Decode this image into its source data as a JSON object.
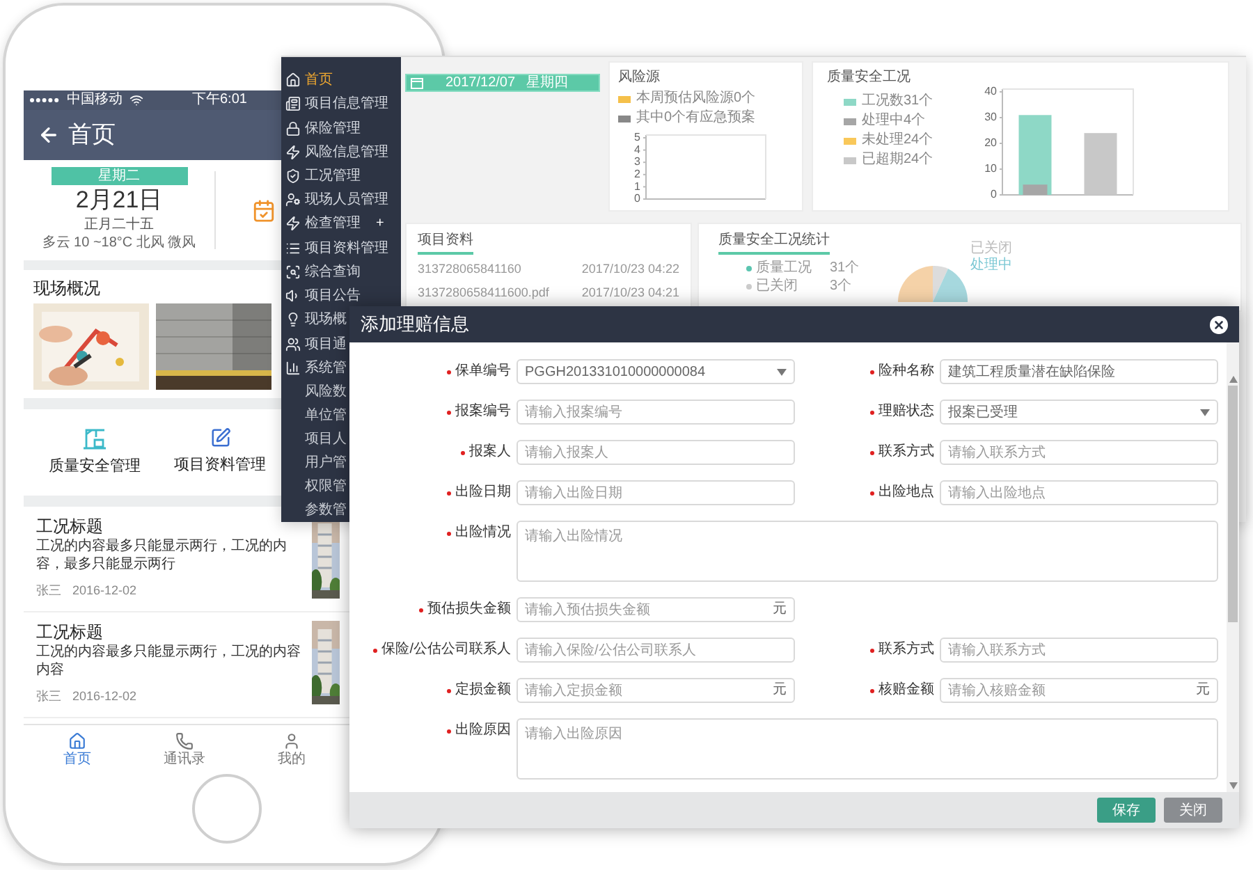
{
  "phone": {
    "status_bar": {
      "carrier": "中国移动",
      "time": "下午6:01"
    },
    "header": {
      "title": "首页"
    },
    "date_card": {
      "weekday": "星期二",
      "date": "2月21日",
      "lunar": "正月二十五",
      "weather": "多云 10 ~18°C 北风 微风"
    },
    "site_overview": {
      "title": "现场概况"
    },
    "shortcuts": [
      {
        "label": "质量安全管理",
        "kind": "crane"
      },
      {
        "label": "项目资料管理",
        "kind": "edit"
      }
    ],
    "news": [
      {
        "title": "工况标题",
        "content": "工况的内容最多只能显示两行，工况的内容，最多只能显示两行",
        "author": "张三",
        "date": "2016-12-02"
      },
      {
        "title": "工况标题",
        "content": "工况的内容最多只能显示两行，工况的内容内容",
        "author": "张三",
        "date": "2016-12-02"
      }
    ],
    "tab_bar": [
      {
        "label": "首页",
        "kind": "home",
        "selected": true
      },
      {
        "label": "通讯录",
        "kind": "phone",
        "selected": false
      },
      {
        "label": "我的",
        "kind": "user",
        "selected": false
      }
    ]
  },
  "dashboard": {
    "sidebar": {
      "items": [
        {
          "label": "首页",
          "kind": "home",
          "selected": true
        },
        {
          "label": "项目信息管理",
          "kind": "news",
          "selected": false
        },
        {
          "label": "保险管理",
          "kind": "lock",
          "selected": false
        },
        {
          "label": "风险信息管理",
          "kind": "bolt",
          "selected": false
        },
        {
          "label": "工况管理",
          "kind": "shield",
          "selected": false
        },
        {
          "label": "现场人员管理",
          "kind": "users",
          "selected": false
        },
        {
          "label": "检查管理",
          "kind": "bolt",
          "selected": false,
          "sign": "+"
        },
        {
          "label": "项目资料管理",
          "kind": "list",
          "selected": false
        },
        {
          "label": "综合查询",
          "kind": "search",
          "selected": false
        },
        {
          "label": "项目公告",
          "kind": "speaker",
          "selected": false
        },
        {
          "label": "现场概",
          "kind": "bulb",
          "selected": false
        },
        {
          "label": "项目通",
          "kind": "group",
          "selected": false
        },
        {
          "label": "系统管",
          "kind": "chart",
          "selected": false,
          "children": [
            {
              "label": "风险数",
              "selected": false
            },
            {
              "label": "单位管",
              "selected": false
            },
            {
              "label": "项目人",
              "selected": false
            },
            {
              "label": "用户管",
              "selected": false
            },
            {
              "label": "权限管",
              "selected": false
            },
            {
              "label": "参数管",
              "selected": false
            }
          ]
        }
      ]
    },
    "date_bar": {
      "date": "2017/12/07",
      "weekday": "星期四"
    },
    "risk_card": {
      "title": "风险源",
      "chart_data": {
        "type": "bar",
        "ylim": [
          0,
          5
        ],
        "yticks": [
          0,
          1,
          2,
          3,
          4,
          5
        ],
        "series": [
          {
            "name": "本周预估风险源0个",
            "color": "#f5c04a",
            "values": [
              0
            ]
          },
          {
            "name": "其中0个有应急预案",
            "color": "#888888",
            "values": [
              0
            ]
          }
        ]
      }
    },
    "quality_card": {
      "title": "质量安全工况",
      "chart_data": {
        "type": "bar",
        "ylim": [
          0,
          40
        ],
        "yticks": [
          0,
          10,
          20,
          30,
          40
        ],
        "series": [
          {
            "name": "工况数31个",
            "color": "#8ed8c6",
            "values": [
              31,
              null
            ]
          },
          {
            "name": "处理中4个",
            "color": "#a6a6a6",
            "values": [
              4,
              null
            ]
          },
          {
            "name": "未处理24个",
            "color": "#f9c85a",
            "values": [
              null,
              null
            ]
          },
          {
            "name": "已超期24个",
            "color": "#c8c8c8",
            "values": [
              null,
              24
            ]
          }
        ]
      }
    },
    "documents": {
      "title": "项目资料",
      "rows": [
        {
          "file": "313728065841160",
          "time": "2017/10/23 04:22"
        },
        {
          "file": "3137280658411600.pdf",
          "time": "2017/10/23 04:21"
        }
      ]
    },
    "stats": {
      "title": "质量安全工况统计",
      "legend": [
        {
          "label": "质量工况",
          "count": "31个",
          "color": "#5bc5b0"
        },
        {
          "label": "已关闭",
          "count": "3个",
          "color": "#cccccc"
        }
      ],
      "pie_labels": [
        {
          "label": "已关闭",
          "color": "#bbbbbb"
        },
        {
          "label": "处理中",
          "color": "#7cc8d4"
        }
      ]
    }
  },
  "dialog": {
    "title": "添加理赔信息",
    "rows": [
      [
        {
          "label": "保单编号",
          "kind": "select",
          "value": "PGGH201331010000000084",
          "required": true
        },
        {
          "label": "险种名称",
          "kind": "text",
          "value": "建筑工程质量潜在缺陷保险",
          "required": true
        }
      ],
      [
        {
          "label": "报案编号",
          "kind": "text",
          "placeholder": "请输入报案编号",
          "required": true
        },
        {
          "label": "理赔状态",
          "kind": "select",
          "value": "报案已受理",
          "required": true
        }
      ],
      [
        {
          "label": "报案人",
          "kind": "text",
          "placeholder": "请输入报案人",
          "required": true
        },
        {
          "label": "联系方式",
          "kind": "text",
          "placeholder": "请输入联系方式",
          "required": true
        }
      ],
      [
        {
          "label": "出险日期",
          "kind": "text",
          "placeholder": "请输入出险日期",
          "required": true
        },
        {
          "label": "出险地点",
          "kind": "text",
          "placeholder": "请输入出险地点",
          "required": true
        }
      ],
      [
        {
          "label": "出险情况",
          "kind": "textarea",
          "placeholder": "请输入出险情况",
          "required": true
        }
      ],
      [
        {
          "label": "预估损失金额",
          "kind": "money",
          "placeholder": "请输入预估损失金额",
          "unit": "元",
          "required": true
        }
      ],
      [
        {
          "label": "保险/公估公司联系人",
          "kind": "text",
          "placeholder": "请输入保险/公估公司联系人",
          "required": true
        },
        {
          "label": "联系方式",
          "kind": "text",
          "placeholder": "请输入联系方式",
          "required": true
        }
      ],
      [
        {
          "label": "定损金额",
          "kind": "money",
          "placeholder": "请输入定损金额",
          "unit": "元",
          "required": true
        },
        {
          "label": "核赔金额",
          "kind": "money",
          "placeholder": "请输入核赔金额",
          "unit": "元",
          "required": true
        }
      ],
      [
        {
          "label": "出险原因",
          "kind": "textarea",
          "placeholder": "请输入出险原因",
          "required": true
        }
      ]
    ],
    "buttons": [
      {
        "label": "保存",
        "kind": "primary"
      },
      {
        "label": "关闭",
        "kind": "secondary"
      }
    ]
  }
}
